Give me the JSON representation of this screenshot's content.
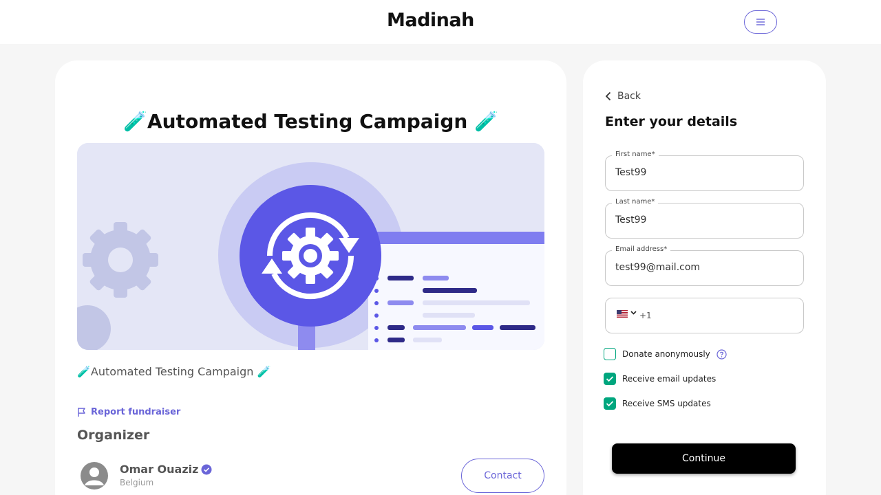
{
  "header": {
    "logo_text": "Madinah",
    "menu_icon": "hamburger-menu-icon"
  },
  "campaign": {
    "title": "Automated Testing Campaign",
    "title_emoji": "🧪",
    "subtitle": "🧪Automated Testing Campaign 🧪",
    "report_label": "Report fundraiser",
    "organizer_heading": "Organizer",
    "organizer": {
      "name": "Omar Ouaziz",
      "country": "Belgium",
      "verified": true
    },
    "contact_label": "Contact"
  },
  "form": {
    "back_label": "Back",
    "title": "Enter your details",
    "first_name": {
      "label": "First name*",
      "value": "Test99"
    },
    "last_name": {
      "label": "Last name*",
      "value": "Test99"
    },
    "email": {
      "label": "Email address*",
      "value": "test99@mail.com"
    },
    "phone": {
      "country_code": "+1",
      "flag": "us-flag-icon"
    },
    "options": [
      {
        "label": "Donate anonymously",
        "checked": false,
        "help": true
      },
      {
        "label": "Receive email updates",
        "checked": true
      },
      {
        "label": "Receive SMS updates",
        "checked": true
      }
    ],
    "continue_label": "Continue"
  },
  "colors": {
    "accent": "#6a65d8",
    "check": "#00a67e",
    "hero_primary": "#5b57e6",
    "hero_bg": "#e4e6f6"
  }
}
